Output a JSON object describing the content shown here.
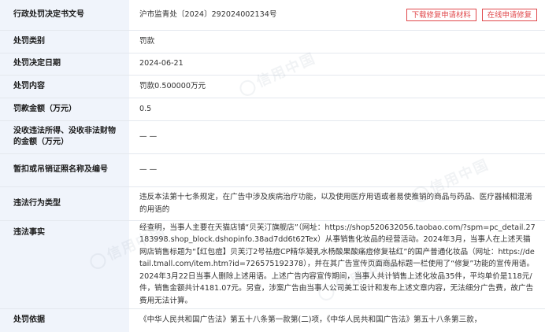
{
  "rows": [
    {
      "label": "行政处罚决定书文号",
      "value": "沪市监青处〔2024〕292024002134号"
    },
    {
      "label": "处罚类别",
      "value": "罚款"
    },
    {
      "label": "处罚决定日期",
      "value": "2024-06-21"
    },
    {
      "label": "处罚内容",
      "value": "罚款0.500000万元"
    },
    {
      "label": "罚款金额（万元）",
      "value": "0.5"
    },
    {
      "label": "没收违法所得、没收非法财物的金额（万元）",
      "value": "— —"
    },
    {
      "label": "暂扣或吊销证照名称及编号",
      "value": "— —"
    },
    {
      "label": "违法行为类型",
      "value": "违反本法第十七条规定，在广告中涉及疾病治疗功能，以及使用医疗用语或者易使推销的商品与药品、医疗器械相混淆的用语的"
    },
    {
      "label": "违法事实",
      "value": "经查明，当事人主要在天猫店铺“贝芙汀旗舰店”（网址：https://shop520632056.taobao.com/?spm=pc_detail.27183998.shop_block.dshopinfo.38ad7dd6t62Tex）从事销售化妆品的经营活动。2024年3月，当事人在上述天猫网店销售标题为“【红包痘】贝芙汀2号祛痘CP精华凝乳水杨酸果酸痛痘修复祛红”的国产普通化妆品（网址：https://detail.tmall.com/item.htm?id=726575192378），并在其广告宣传页面商品标题一栏使用了“修复”功能的宣传用语。2024年3月22日当事人删除上述用语。上述广告内容宣传期间，当事人共计销售上述化妆品35件，平均单价是118元/件，销售金额共计4181.07元。另查，涉案广告由当事人公司美工设计和发布上述文章内容，无法细分广告费，故广告费用无法计算。"
    },
    {
      "label": "处罚依据",
      "value": "《中华人民共和国广告法》第五十八条第一款第(二)项，《中华人民共和国广告法》第五十八条第三款，"
    }
  ],
  "buttons": {
    "download": "下载修复申请材料",
    "online": "在线申请修复"
  },
  "watermark": "信用中国",
  "colors": {
    "label_bg": "#f0f4fb",
    "accent": "#e0484b",
    "border": "#e4e8ee"
  }
}
